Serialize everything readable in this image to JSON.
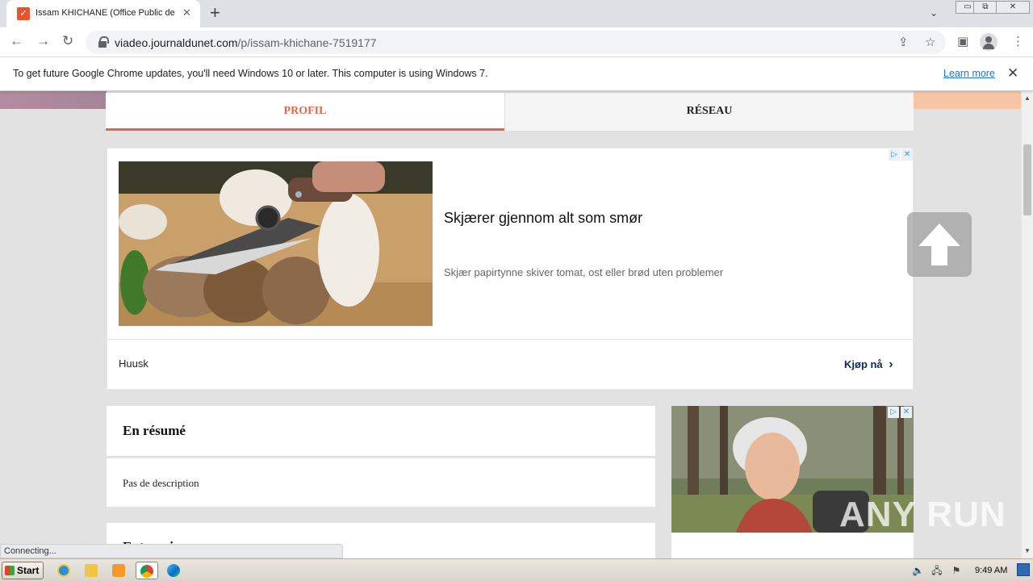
{
  "browser": {
    "tab": {
      "title": "Issam KHICHANE (Office Public de Tra",
      "close": "✕",
      "favicon": "viadeo-logo-icon"
    },
    "new_tab": "+",
    "tab_search": "⌄",
    "window_buttons": {
      "minimize": "▭",
      "restore": "⧉",
      "close": "✕"
    },
    "nav": {
      "back": "←",
      "forward": "→",
      "reload": "↻"
    },
    "address": {
      "domain": "viadeo.journaldunet.com",
      "path": "/p/issam-khichane-7519177"
    },
    "omnibox_icons": {
      "share": "⇪",
      "bookmark": "☆"
    },
    "toolbar_icons": {
      "side_panel": "▣",
      "menu": "⋮"
    },
    "infobar": {
      "message": "To get future Google Chrome updates, you'll need Windows 10 or later. This computer is using Windows 7.",
      "link": "Learn more",
      "close": "✕"
    },
    "status": "Connecting..."
  },
  "page": {
    "tabs": [
      {
        "label": "PROFIL",
        "active": true
      },
      {
        "label": "RÉSEAU",
        "active": false
      }
    ],
    "ad_main": {
      "headline": "Skjærer gjennom alt som smør",
      "description": "Skjær papirtynne skiver tomat, ost eller brød uten problemer",
      "brand": "Huusk",
      "cta": "Kjøp nå",
      "cta_arrow": "›",
      "adchoice": "▷",
      "adclose": "✕"
    },
    "ad_side": {
      "adchoice": "▷",
      "adclose": "✕"
    },
    "summary": {
      "title": "En résumé",
      "text": "Pas de description"
    },
    "next_section_title": "Entreprises",
    "watermark": "ANY RUN"
  },
  "scrollbar": {
    "up": "▲",
    "down": "▼"
  },
  "taskbar": {
    "start": "Start",
    "apps": [
      "internet-explorer-icon",
      "file-explorer-icon",
      "media-player-icon",
      "chrome-icon",
      "edge-icon"
    ],
    "tray": {
      "volume": "🔈",
      "network": "🖧",
      "flag": "⚑"
    },
    "clock": "9:49 AM"
  },
  "colors": {
    "accent": "#e0684a",
    "link": "#1a73e8",
    "cta": "#0b2a5a"
  }
}
